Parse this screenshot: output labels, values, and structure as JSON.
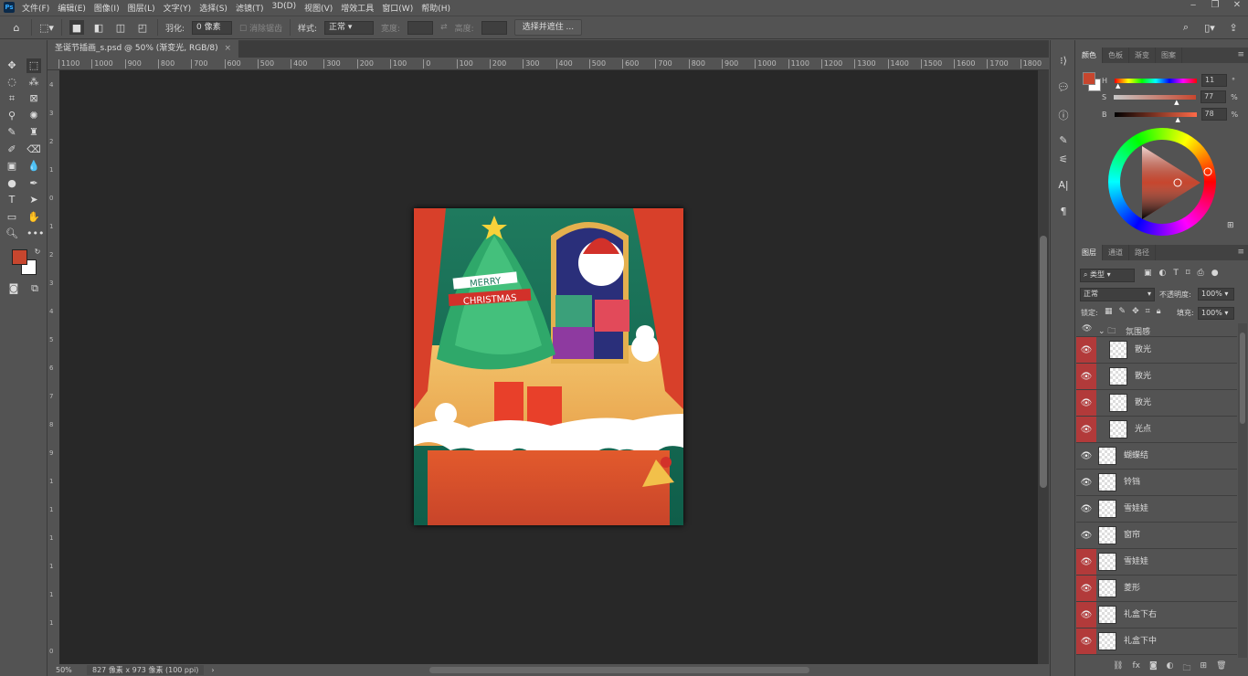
{
  "menubar": {
    "logo": "Ps",
    "items": [
      "文件(F)",
      "编辑(E)",
      "图像(I)",
      "图层(L)",
      "文字(Y)",
      "选择(S)",
      "滤镜(T)",
      "3D(D)",
      "视图(V)",
      "增效工具",
      "窗口(W)",
      "帮助(H)"
    ]
  },
  "window_controls": {
    "minimize": "‒",
    "restore": "❐",
    "close": "✕"
  },
  "options_bar": {
    "feather_label": "羽化:",
    "feather_value": "0 像素",
    "antialias_label": "消除锯齿",
    "style_label": "样式:",
    "style_value": "正常",
    "width_label": "宽度:",
    "height_label": "高度:",
    "select_mask_button": "选择并遮住 ..."
  },
  "document_tab": {
    "title": "圣诞节插画_s.psd @ 50% (渐变光, RGB/8)",
    "close": "×"
  },
  "ruler": {
    "h_labels": [
      "1100",
      "1000",
      "900",
      "800",
      "700",
      "600",
      "500",
      "400",
      "300",
      "200",
      "100",
      "0",
      "100",
      "200",
      "300",
      "400",
      "500",
      "600",
      "700",
      "800",
      "900",
      "1000",
      "1100",
      "1200",
      "1300",
      "1400",
      "1500",
      "1600",
      "1700",
      "1800",
      "1"
    ],
    "v_labels": [
      "4",
      "3",
      "2",
      "1",
      "0",
      "1",
      "2",
      "3",
      "4",
      "5",
      "6",
      "7",
      "8",
      "9",
      "1",
      "1",
      "1",
      "1",
      "1",
      "1",
      "0"
    ]
  },
  "canvas_art": {
    "banner_line1": "MERRY",
    "banner_line2": "CHRISTMAS"
  },
  "status": {
    "zoom": "50%",
    "doc_info": "827 像素 x 973 像素 (100 ppi)",
    "arrow": "›"
  },
  "color_panel": {
    "tabs": [
      "颜色",
      "色板",
      "渐变",
      "图案"
    ],
    "h_label": "H",
    "h_value": "11",
    "h_unit": "°",
    "s_label": "S",
    "s_value": "77",
    "s_unit": "%",
    "b_label": "B",
    "b_value": "78",
    "b_unit": "%",
    "foreground": "#c7462e",
    "background": "#ffffff"
  },
  "layers_panel": {
    "tabs": [
      "图层",
      "通道",
      "路径"
    ],
    "filter": "类型",
    "blend_mode": "正常",
    "opacity_label": "不透明度:",
    "opacity_value": "100%",
    "lock_label": "锁定:",
    "fill_label": "填充:",
    "fill_value": "100%",
    "group": "氛围感",
    "layers": [
      {
        "name": "散光",
        "eye_highlight": true,
        "indented": true
      },
      {
        "name": "散光",
        "eye_highlight": true,
        "indented": true
      },
      {
        "name": "散光",
        "eye_highlight": true,
        "indented": true
      },
      {
        "name": "光点",
        "eye_highlight": true,
        "indented": true
      },
      {
        "name": "蝴蝶结",
        "eye_highlight": false
      },
      {
        "name": "铃铛",
        "eye_highlight": false
      },
      {
        "name": "雪娃娃",
        "eye_highlight": false
      },
      {
        "name": "窗帘",
        "eye_highlight": false
      },
      {
        "name": "雪娃娃",
        "eye_highlight": true
      },
      {
        "name": "菱形",
        "eye_highlight": true
      },
      {
        "name": "礼盒下右",
        "eye_highlight": true
      },
      {
        "name": "礼盒下中",
        "eye_highlight": true
      }
    ]
  }
}
